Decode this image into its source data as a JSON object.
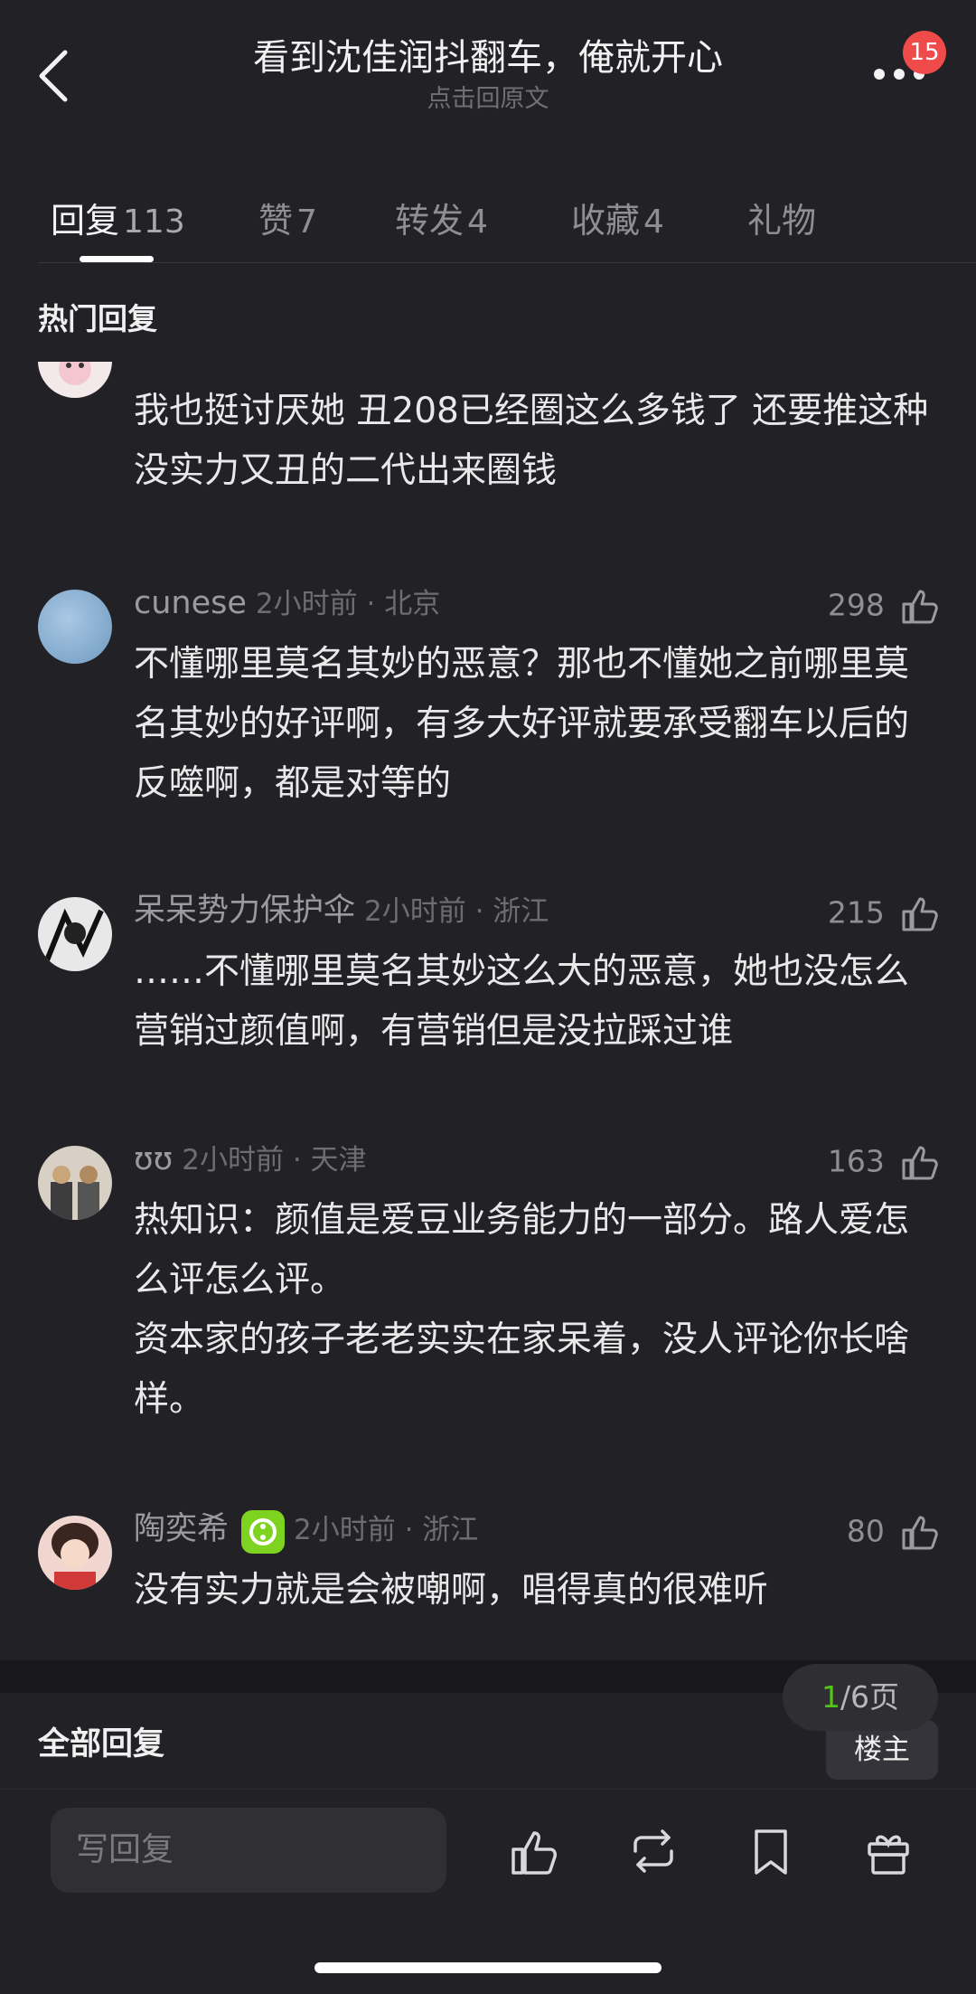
{
  "header": {
    "title": "看到沈佳润抖翻车，俺就开心",
    "subtitle": "点击回原文",
    "badge": "15"
  },
  "tabs": [
    {
      "label": "回复",
      "count": "113"
    },
    {
      "label": "赞",
      "count": "7"
    },
    {
      "label": "转发",
      "count": "4"
    },
    {
      "label": "收藏",
      "count": "4"
    },
    {
      "label": "礼物",
      "count": ""
    }
  ],
  "section_title": "热门回复",
  "comments": [
    {
      "username": "",
      "time": "",
      "likes": "",
      "text": "我也挺讨厌她 丑208已经圈这么多钱了 还要推这种没实力又丑的二代出来圈钱"
    },
    {
      "username": "cunese",
      "time": "2小时前 · 北京",
      "likes": "298",
      "text": "不懂哪里莫名其妙的恶意？那也不懂她之前哪里莫名其妙的好评啊，有多大好评就要承受翻车以后的反噬啊，都是对等的"
    },
    {
      "username": "呆呆势力保护伞",
      "time": "2小时前 · 浙江",
      "likes": "215",
      "text": "……不懂哪里莫名其妙这么大的恶意，她也没怎么营销过颜值啊，有营销但是没拉踩过谁"
    },
    {
      "username": "ʊʊ",
      "time": "2小时前 · 天津",
      "likes": "163",
      "text_lines": [
        "热知识：颜值是爱豆业务能力的一部分。路人爱怎么评怎么评。",
        "资本家的孩子老老实实在家呆着，没人评论你长啥样。"
      ]
    },
    {
      "username": "陶奕希",
      "time": "2小时前 · 浙江",
      "likes": "80",
      "text": "没有实力就是会被嘲啊，唱得真的很难听"
    }
  ],
  "pager": {
    "current": "1",
    "total": "/6页"
  },
  "all_replies_label": "全部回复",
  "owner_button": "楼主",
  "input_placeholder": "写回复",
  "icons": [
    "back-icon",
    "more-icon",
    "like-icon",
    "repost-icon",
    "bookmark-icon",
    "gift-icon"
  ]
}
